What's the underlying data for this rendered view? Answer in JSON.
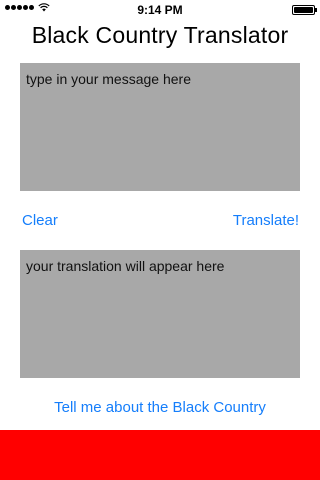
{
  "status_bar": {
    "time": "9:14 PM"
  },
  "app": {
    "title": "Black Country Translator"
  },
  "input": {
    "placeholder": "type in your message here"
  },
  "actions": {
    "clear_label": "Clear",
    "translate_label": "Translate!"
  },
  "output": {
    "placeholder": "your translation will appear here"
  },
  "about": {
    "label": "Tell me about the Black Country"
  },
  "colors": {
    "accent": "#157efb",
    "text_area_bg": "#a8a8a8",
    "banner": "#ff0000"
  }
}
